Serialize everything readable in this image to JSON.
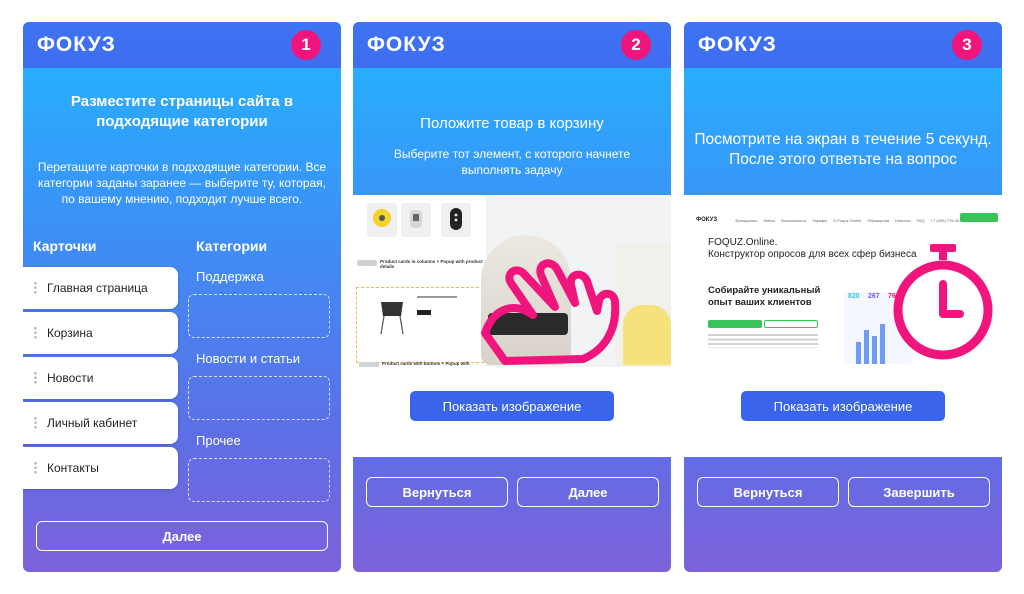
{
  "brand": "ФОКУЗ",
  "screens": [
    {
      "step": "1",
      "title": "Разместите страницы сайта в подходящие категории",
      "subtitle": "Перетащите карточки в подходящие категории. Все категории заданы заранее — выберите ту, которая, по вашему мнению, подходит лучше всего.",
      "cards_header": "Карточки",
      "categories_header": "Категории",
      "cards": [
        "Главная страница",
        "Корзина",
        "Новости",
        "Личный кабинет",
        "Контакты"
      ],
      "categories": [
        "Поддержка",
        "Новости и статьи",
        "Прочее"
      ],
      "next_button": "Далее"
    },
    {
      "step": "2",
      "title": "Положите товар в корзину",
      "subtitle": "Выберите тот элемент, с которого начнете выполнять задачу",
      "screenshot_text": [
        "Product cards in columns + Popup with product details",
        "Product cards with buttons + Popup with",
        "Add to cart"
      ],
      "show_image_button": "Показать изображение",
      "back_button": "Вернуться",
      "next_button": "Далее",
      "icon": "pointing-hand-icon"
    },
    {
      "step": "3",
      "title": "Посмотрите на экран в течение 5 секунд. После этого ответьте на вопрос",
      "screenshot": {
        "logo": "ФОКУЗ",
        "nav": [
          "Функционал",
          "Кейсы",
          "Возможности",
          "Тарифы",
          "О Foquz.Online",
          "Обращения",
          "Новости",
          "FAQ"
        ],
        "phone": "+7 (495) 775-40-98",
        "heading": "FOQUZ.Online.",
        "subheading": "Конструктор опросов для всех сфер бизнеса",
        "promo": "Собирайте уникальный опыт ваших клиентов",
        "stats": [
          "820",
          "267",
          "76"
        ]
      },
      "show_image_button": "Показать изображение",
      "back_button": "Вернуться",
      "finish_button": "Завершить",
      "icon": "stopwatch-icon"
    }
  ],
  "colors": {
    "badge": "#f0157c",
    "button_blue": "#3a64ea",
    "gradient_top": "#22b6ff",
    "gradient_bottom": "#7d61da",
    "accent_pink": "#f0157c"
  }
}
